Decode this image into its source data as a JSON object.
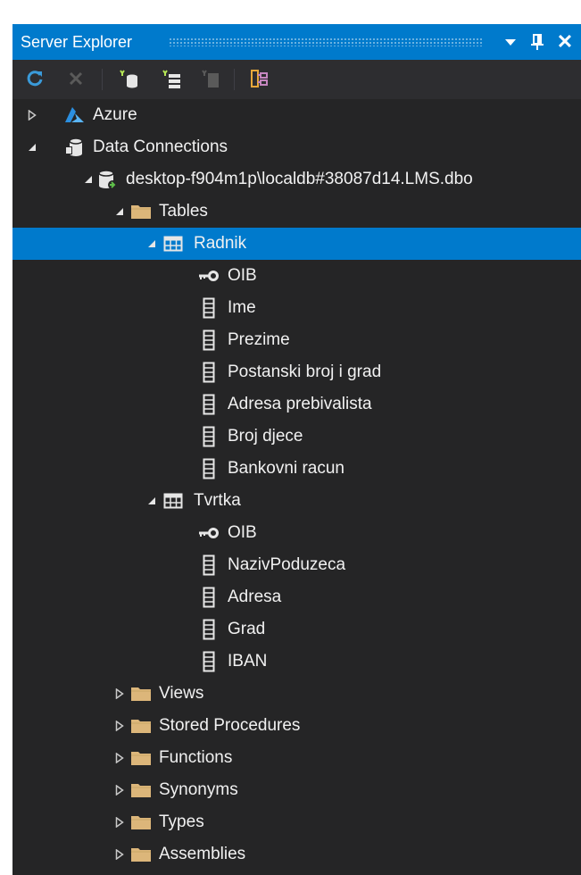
{
  "panel": {
    "title": "Server Explorer",
    "title_buttons": [
      "dropdown-arrow-icon",
      "pin-icon",
      "close-icon"
    ],
    "close_glyph": "✕",
    "colors": {
      "accent": "#007acc",
      "background": "#252526",
      "text": "#f1f1f1",
      "folder": "#dcb67a"
    }
  },
  "toolbar": {
    "buttons": [
      {
        "name": "refresh-button",
        "icon": "refresh-icon",
        "enabled": true
      },
      {
        "name": "stop-button",
        "icon": "stop-icon",
        "enabled": false
      },
      {
        "name": "connect-to-database-button",
        "icon": "connect-database-icon",
        "enabled": true
      },
      {
        "name": "connect-to-server-button",
        "icon": "connect-server-icon",
        "enabled": true
      },
      {
        "name": "connect-to-sharepoint-button",
        "icon": "connect-sharepoint-icon",
        "enabled": false
      },
      {
        "name": "class-diagram-button",
        "icon": "class-diagram-icon",
        "enabled": true
      }
    ]
  },
  "tree": {
    "items": [
      {
        "label": "Azure",
        "level": 0,
        "expander": "collapsed",
        "icon": "azure-icon"
      },
      {
        "label": "Data Connections",
        "level": 0,
        "expander": "expanded",
        "icon": "data-connections-icon"
      },
      {
        "label": "desktop-f904m1p\\localdb#38087d14.LMS.dbo",
        "level": 1,
        "expander": "expanded",
        "icon": "database-connection-icon"
      },
      {
        "label": "Tables",
        "level": 2,
        "expander": "expanded",
        "icon": "folder-icon"
      },
      {
        "label": "Radnik",
        "level": 3,
        "expander": "expanded",
        "icon": "table-icon",
        "selected": true
      },
      {
        "label": "OIB",
        "level": 4,
        "expander": "none",
        "icon": "primary-key-icon"
      },
      {
        "label": "Ime",
        "level": 4,
        "expander": "none",
        "icon": "column-icon"
      },
      {
        "label": "Prezime",
        "level": 4,
        "expander": "none",
        "icon": "column-icon"
      },
      {
        "label": "Postanski broj i grad",
        "level": 4,
        "expander": "none",
        "icon": "column-icon"
      },
      {
        "label": "Adresa prebivalista",
        "level": 4,
        "expander": "none",
        "icon": "column-icon"
      },
      {
        "label": "Broj djece",
        "level": 4,
        "expander": "none",
        "icon": "column-icon"
      },
      {
        "label": "Bankovni racun",
        "level": 4,
        "expander": "none",
        "icon": "column-icon"
      },
      {
        "label": "Tvrtka",
        "level": 3,
        "expander": "expanded",
        "icon": "table-icon"
      },
      {
        "label": "OIB",
        "level": 4,
        "expander": "none",
        "icon": "primary-key-icon"
      },
      {
        "label": "NazivPoduzeca",
        "level": 4,
        "expander": "none",
        "icon": "column-icon"
      },
      {
        "label": "Adresa",
        "level": 4,
        "expander": "none",
        "icon": "column-icon"
      },
      {
        "label": "Grad",
        "level": 4,
        "expander": "none",
        "icon": "column-icon"
      },
      {
        "label": "IBAN",
        "level": 4,
        "expander": "none",
        "icon": "column-icon"
      },
      {
        "label": "Views",
        "level": 2,
        "expander": "collapsed",
        "icon": "folder-icon"
      },
      {
        "label": "Stored Procedures",
        "level": 2,
        "expander": "collapsed",
        "icon": "folder-icon"
      },
      {
        "label": "Functions",
        "level": 2,
        "expander": "collapsed",
        "icon": "folder-icon"
      },
      {
        "label": "Synonyms",
        "level": 2,
        "expander": "collapsed",
        "icon": "folder-icon"
      },
      {
        "label": "Types",
        "level": 2,
        "expander": "collapsed",
        "icon": "folder-icon"
      },
      {
        "label": "Assemblies",
        "level": 2,
        "expander": "collapsed",
        "icon": "folder-icon"
      }
    ]
  }
}
